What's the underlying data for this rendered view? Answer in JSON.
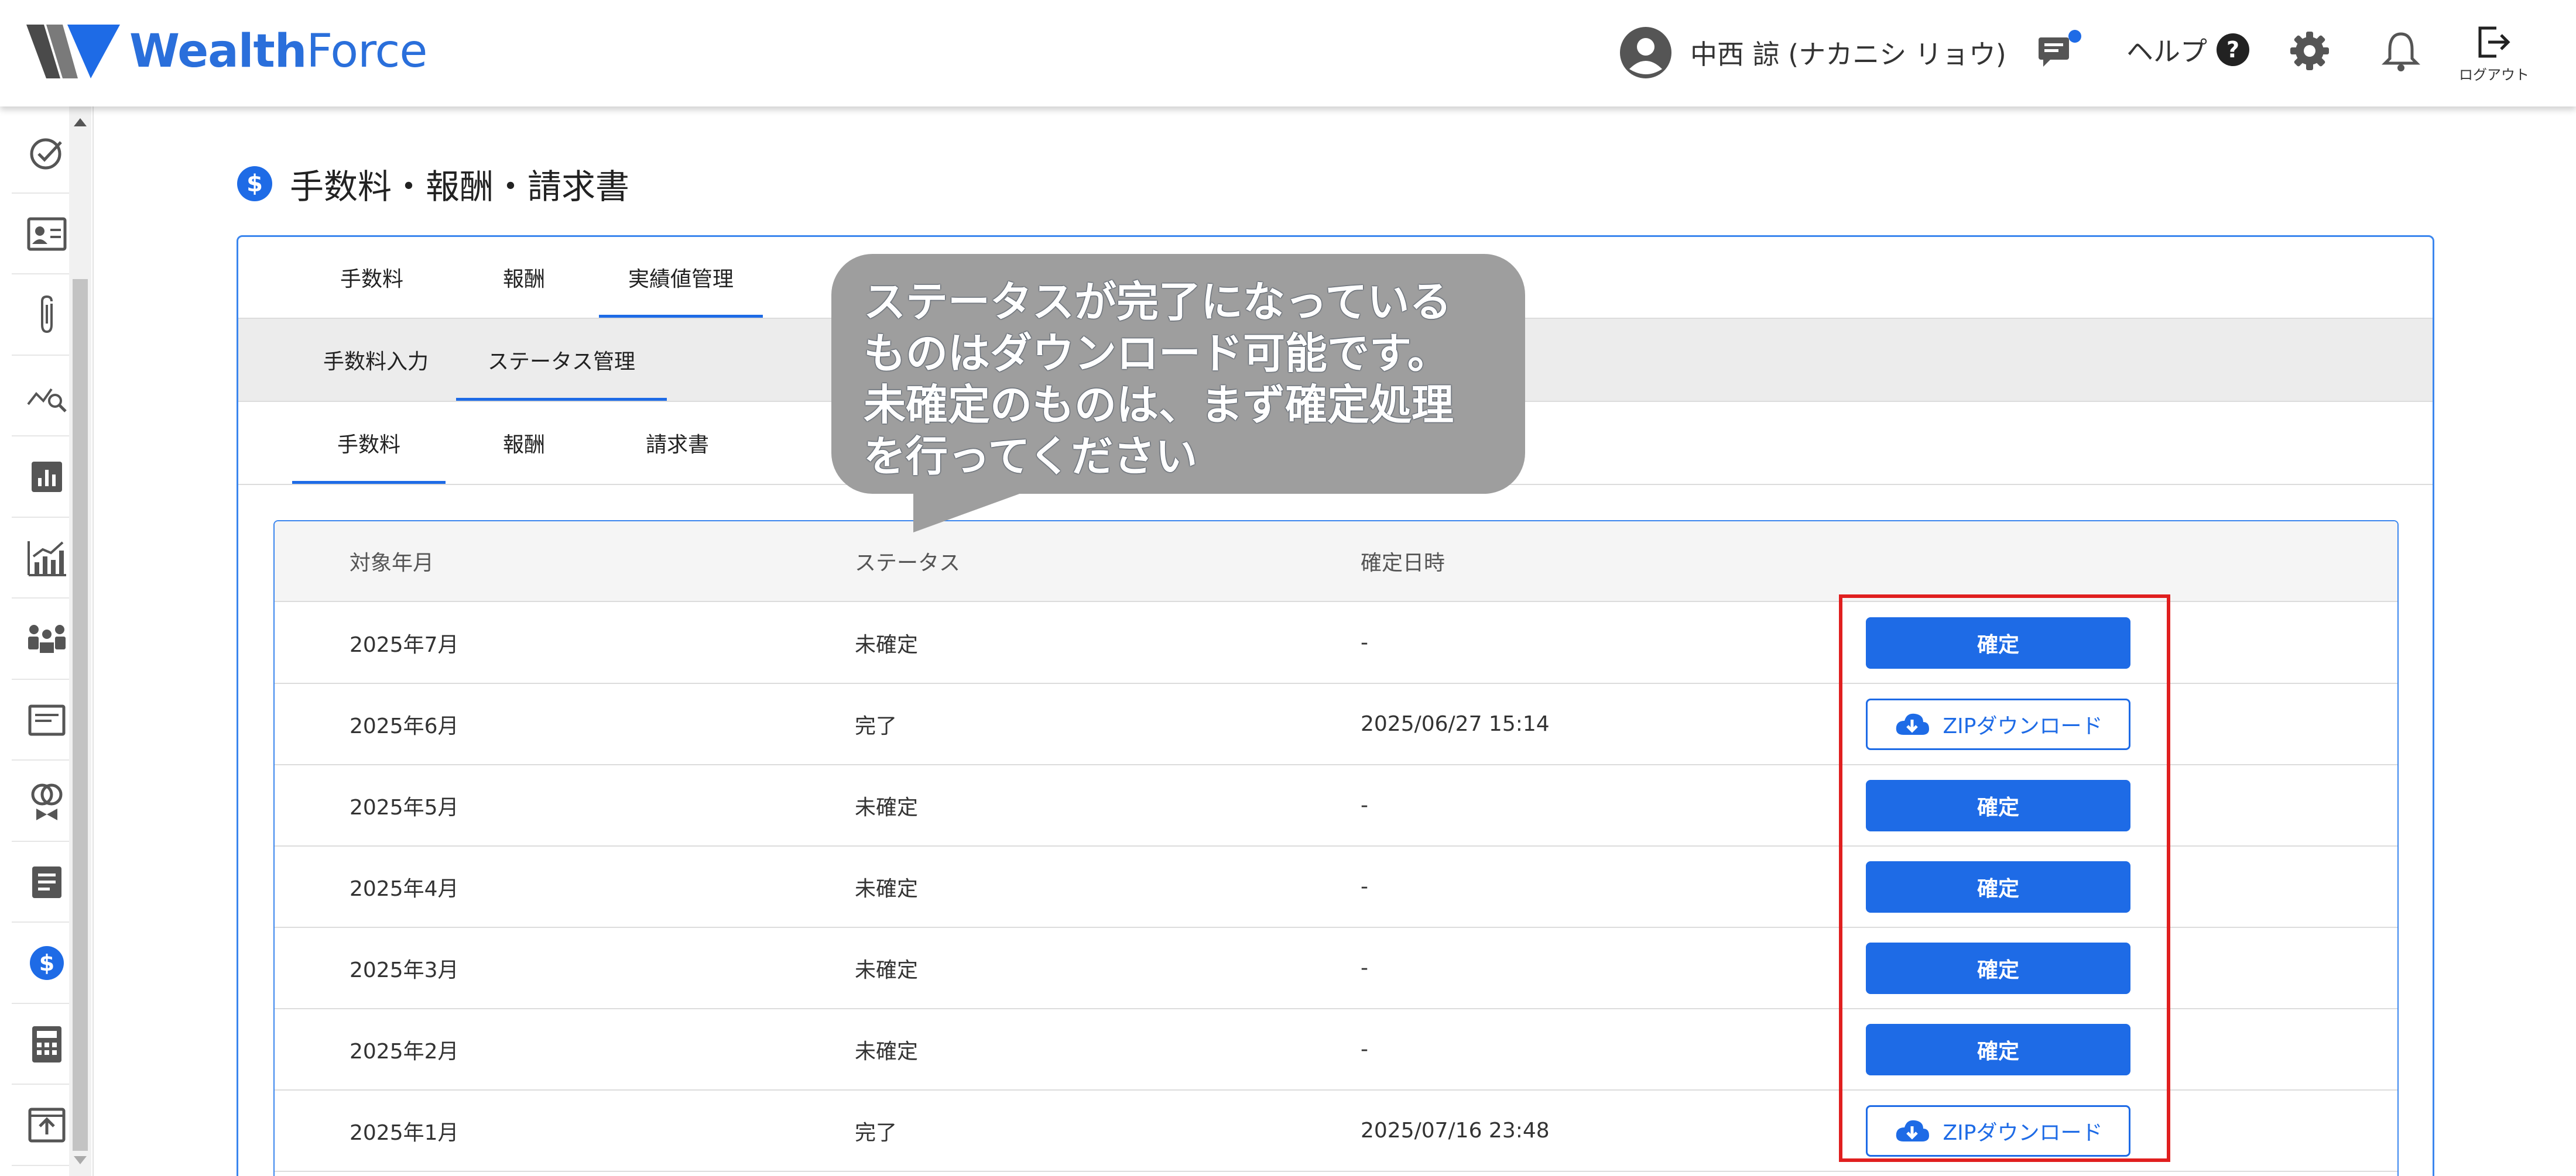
{
  "app": {
    "name_prefix": "Wealth",
    "name_suffix": "Force"
  },
  "header": {
    "user_name": "中西 諒 (ナカニシ リョウ)",
    "help_label": "ヘルプ",
    "logout_label": "ログアウト"
  },
  "sidebar": {
    "icons": [
      "check-circle-icon",
      "contact-card-icon",
      "paperclip-icon",
      "chart-search-icon",
      "bar-chart-icon",
      "growth-chart-icon",
      "meeting-icon",
      "document-card-icon",
      "rings-icon",
      "notes-icon",
      "dollar-circle-icon",
      "calculator-icon",
      "upload-screen-icon"
    ],
    "active_index": 10
  },
  "page": {
    "title": "手数料・報酬・請求書"
  },
  "tabs": {
    "level1": [
      "手数料",
      "報酬",
      "実績値管理"
    ],
    "level1_active": "実績値管理",
    "level2": [
      "手数料入力",
      "ステータス管理"
    ],
    "level2_active": "ステータス管理",
    "level3": [
      "手数料",
      "報酬",
      "請求書"
    ],
    "level3_active": "手数料"
  },
  "table": {
    "headers": [
      "対象年月",
      "ステータス",
      "確定日時",
      ""
    ],
    "rows": [
      {
        "month": "2025年7月",
        "status": "未確定",
        "confirmed_at": "-",
        "action": "確定",
        "action_type": "confirm"
      },
      {
        "month": "2025年6月",
        "status": "完了",
        "confirmed_at": "2025/06/27 15:14",
        "action": "ZIPダウンロード",
        "action_type": "zip"
      },
      {
        "month": "2025年5月",
        "status": "未確定",
        "confirmed_at": "-",
        "action": "確定",
        "action_type": "confirm"
      },
      {
        "month": "2025年4月",
        "status": "未確定",
        "confirmed_at": "-",
        "action": "確定",
        "action_type": "confirm"
      },
      {
        "month": "2025年3月",
        "status": "未確定",
        "confirmed_at": "-",
        "action": "確定",
        "action_type": "confirm"
      },
      {
        "month": "2025年2月",
        "status": "未確定",
        "confirmed_at": "-",
        "action": "確定",
        "action_type": "confirm"
      },
      {
        "month": "2025年1月",
        "status": "完了",
        "confirmed_at": "2025/07/16 23:48",
        "action": "ZIPダウンロード",
        "action_type": "zip"
      }
    ]
  },
  "callout": {
    "lines": [
      "ステータスが完了になっている",
      "ものはダウンロード可能です。",
      "未確定のものは、まず確定処理",
      "を行ってください"
    ]
  },
  "colors": {
    "accent": "#1e6be6",
    "highlight": "#e01f1f",
    "callout_bg": "#9e9e9e"
  }
}
